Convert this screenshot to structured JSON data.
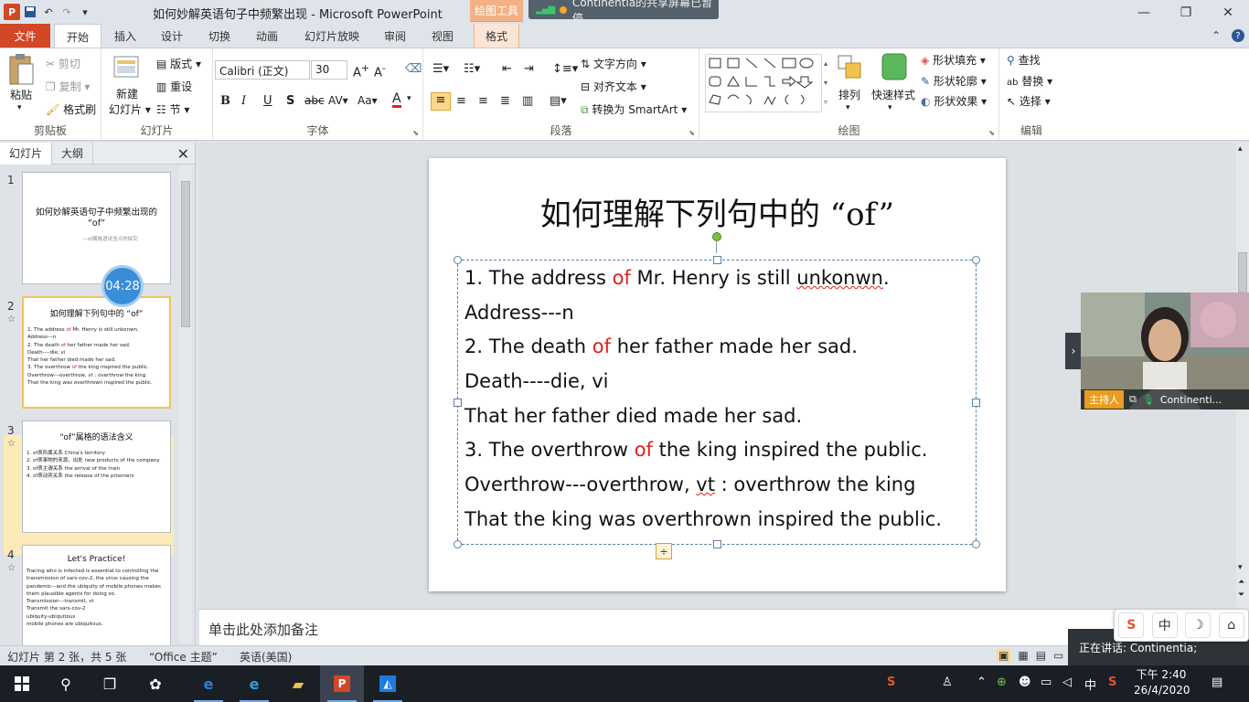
{
  "window": {
    "title": "如何妙解英语句子中频繁出现 - Microsoft PowerPoint",
    "contextual_tools": "绘图工具",
    "share_banner": "Continentia的共享屏幕已暂停"
  },
  "tabs": [
    "文件",
    "开始",
    "插入",
    "设计",
    "切换",
    "动画",
    "幻灯片放映",
    "审阅",
    "视图",
    "格式"
  ],
  "ribbon": {
    "clipboard": {
      "label": "剪贴板",
      "paste": "粘贴",
      "cut": "剪切",
      "copy": "复制",
      "format_painter": "格式刷"
    },
    "slides": {
      "label": "幻灯片",
      "new_slide_1": "新建",
      "new_slide_2": "幻灯片",
      "layout": "版式",
      "reset": "重设",
      "section": "节"
    },
    "font": {
      "label": "字体",
      "name": "Calibri (正文)",
      "size": "30"
    },
    "paragraph": {
      "label": "段落",
      "text_direction": "文字方向",
      "align_text": "对齐文本",
      "smartart": "转换为 SmartArt"
    },
    "drawing": {
      "label": "绘图",
      "arrange": "排列",
      "quick_styles": "快速样式",
      "shape_fill": "形状填充",
      "shape_outline": "形状轮廓",
      "shape_effects": "形状效果"
    },
    "editing": {
      "label": "编辑",
      "find": "查找",
      "replace": "替换",
      "select": "选择"
    }
  },
  "panel": {
    "tabs": [
      "幻灯片",
      "大纲"
    ],
    "timer": "04:28",
    "thumbnails": [
      {
        "num": "1",
        "title": "如何妙解英语句子中频繁出现的 “of”",
        "subtitle": "—of属格语法含义的探究"
      },
      {
        "num": "2",
        "title": "如何理解下列句中的 “of”",
        "lines": [
          "1. The address of Mr. Henry is still unkonwn.",
          "Address---n",
          "2. The death of her father made her sad.",
          "Death----die, vi",
          "That her father died made her sad.",
          "3. The overthrow of the king inspired the public.",
          "Overthrow---overthrow, vt : overthrow the king",
          "That the king was overthrown inspired the public."
        ]
      },
      {
        "num": "3",
        "title": "“of”属格的语法含义",
        "lines": [
          "1. of表所属关系 China's territory",
          "2. of表事物的来源，出处 new products of the company",
          "3. of表主谓关系 the arrival of the train",
          "4. of表动宾关系 the release of the prisoners"
        ]
      },
      {
        "num": "4",
        "title": "Let's Practice!",
        "lines": [
          "Tracing who is infected is essential to controlling the transmission of sars-cov-2, the virus causing the pandemic—and the ubiquity of mobile phones makes them plausible agents for doing so.",
          "Transmission---transmit, vt",
          "Transmit the sars-cov-2",
          "ubiquity-ubiquitous",
          "mobile phones are ubiquitous."
        ]
      }
    ]
  },
  "slide": {
    "title": "如何理解下列句中的 “of”",
    "lines": [
      {
        "pre": "1. The address ",
        "of": "of",
        "post": " Mr. Henry is still ",
        "err": "unkonwn",
        "end": "."
      },
      {
        "text": "Address---n"
      },
      {
        "pre": "2. The death ",
        "of": "of",
        "post": " her father made her sad."
      },
      {
        "text": "Death----die, vi"
      },
      {
        "text": "That her father died made her sad."
      },
      {
        "pre": "3. The overthrow ",
        "of": "of",
        "post": " the king inspired the public."
      },
      {
        "pre": "Overthrow---overthrow, ",
        "err": "vt",
        "post": " : overthrow the king"
      },
      {
        "text": "That the king was overthrown inspired the public."
      }
    ]
  },
  "notes_placeholder": "单击此处添加备注",
  "status": {
    "slide_info": "幻灯片 第 2 张，共 5 张",
    "theme": "“Office 主题”",
    "language": "英语(美国)"
  },
  "video": {
    "host_badge": "主持人",
    "name": "Continenti..."
  },
  "speaking": "正在讲话: Continentia;",
  "ime": [
    "中"
  ],
  "clock": {
    "time": "下午 2:40",
    "date": "26/4/2020"
  },
  "tray_lang": "中"
}
